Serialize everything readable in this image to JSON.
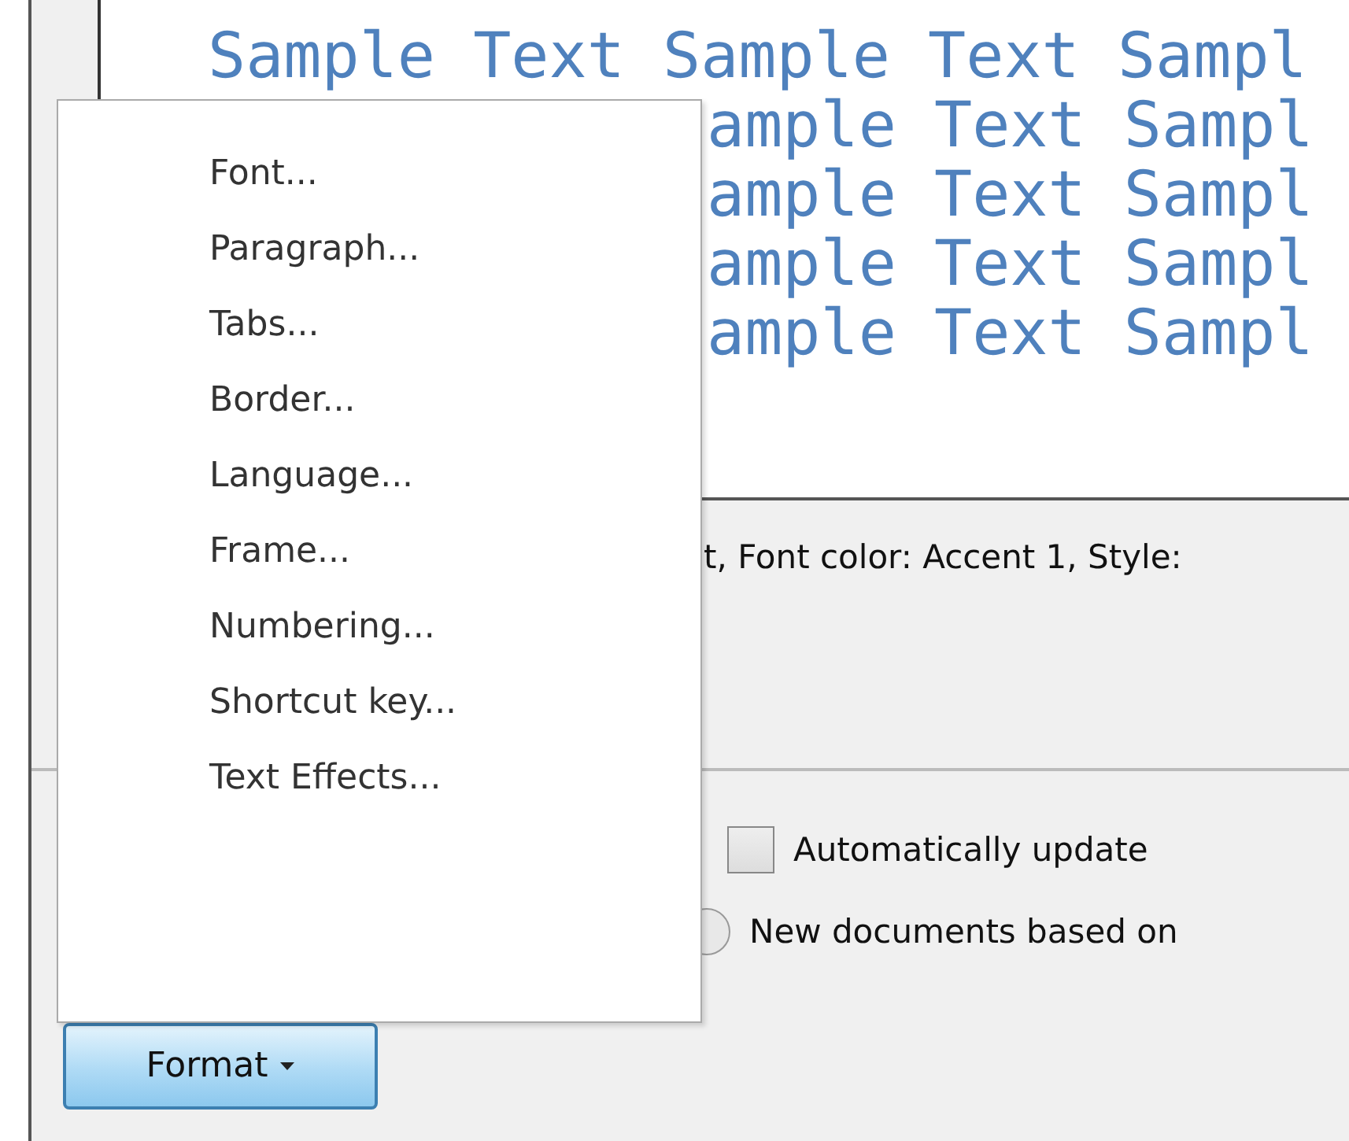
{
  "preview": {
    "lines": [
      "Sample Text Sample Text Sampl",
      "ample Text Sampl",
      "ample Text Sampl",
      "ample Text Sampl",
      "ample Text Sampl"
    ]
  },
  "description": "t, Font color: Accent 1, Style:",
  "options": [
    {
      "kind": "checkbox",
      "label": "Automatically update",
      "checked": false
    },
    {
      "kind": "radio",
      "label": "New documents based on",
      "selected": false
    }
  ],
  "format_menu": {
    "items": [
      {
        "label": "Font..."
      },
      {
        "label": "Paragraph..."
      },
      {
        "label": "Tabs..."
      },
      {
        "label": "Border..."
      },
      {
        "label": "Language..."
      },
      {
        "label": "Frame..."
      },
      {
        "label": "Numbering..."
      },
      {
        "label": "Shortcut key..."
      },
      {
        "label": "Text Effects..."
      }
    ]
  },
  "format_button": {
    "label": "Format",
    "expanded": true
  }
}
